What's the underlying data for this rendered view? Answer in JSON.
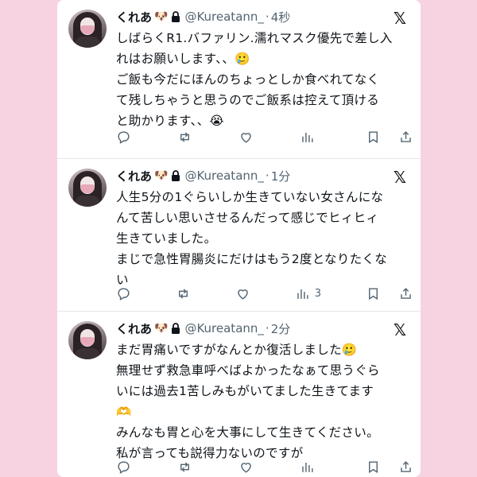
{
  "tweets": [
    {
      "name": "くれあ",
      "name_emoji": "🐶",
      "handle": "@Kureatann_",
      "separator": "·",
      "time": "4秒",
      "lines": [
        "しばらくR1.バファリン.濡れマスク優先で差し入",
        "れはお願いします、、🥲",
        "ご飯も今だにほんのちょっとしか食べれてなく",
        "て残しちゃうと思うのでご飯系は控えて頂ける",
        "と助かります、、😭"
      ],
      "views": ""
    },
    {
      "name": "くれあ",
      "name_emoji": "🐶",
      "handle": "@Kureatann_",
      "separator": "·",
      "time": "1分",
      "lines": [
        "人生5分の1ぐらいしか生きていない女さんにな",
        "んて苦しい思いさせるんだって感じでヒィヒィ",
        "生きていました。",
        "まじで急性胃腸炎にだけはもう2度となりたくな",
        "い"
      ],
      "views": "3"
    },
    {
      "name": "くれあ",
      "name_emoji": "🐶",
      "handle": "@Kureatann_",
      "separator": "·",
      "time": "2分",
      "lines": [
        "まだ胃痛いですがなんとか復活しました🥲",
        "無理せず救急車呼べばよかったなぁて思うぐら",
        "いには過去1苦しみもがいてました生きてます",
        "🫶",
        "みんなも胃と心を大事にして生きてください。",
        "私が言っても説得力ないのですが"
      ],
      "views": ""
    }
  ],
  "icons": [
    "lock-icon",
    "x-logo-icon",
    "reply-icon",
    "retweet-icon",
    "like-icon",
    "views-icon",
    "bookmark-icon",
    "share-icon"
  ],
  "colors": {
    "background": "#f7d3e2",
    "panel": "#ffffff",
    "muted": "#536471",
    "text": "#0f1419"
  }
}
